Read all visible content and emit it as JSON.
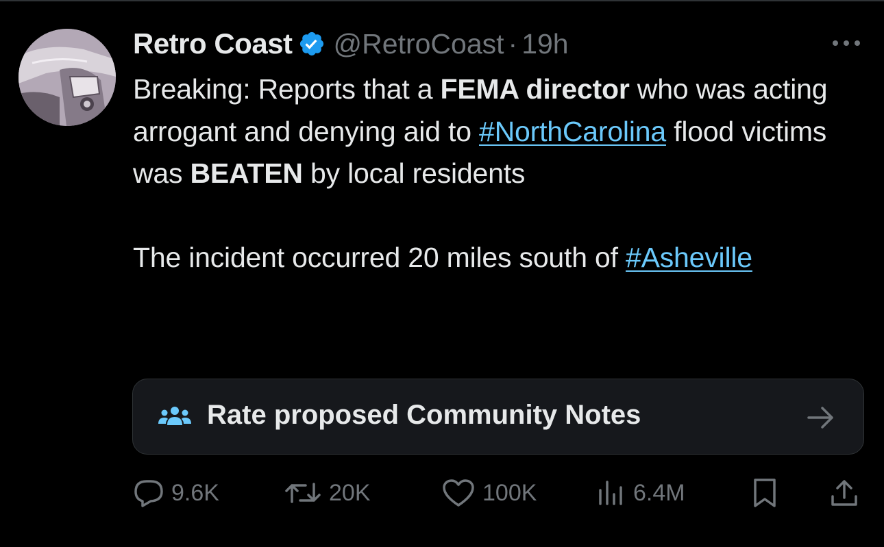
{
  "tweet": {
    "display_name": "Retro Coast",
    "handle": "@RetroCoast",
    "separator": "·",
    "timestamp": "19h",
    "more_label": "More",
    "text": {
      "p1_a": "Breaking: Reports that a ",
      "p1_b": "FEMA director",
      "p1_c": " who was acting arrogant and denying aid to ",
      "p1_hashtag": "#NorthCarolina",
      "p1_d": " flood victims was ",
      "p1_e": "BEATEN",
      "p1_f": " by local residents",
      "p2_a": "The incident occurred 20 miles south of ",
      "p2_hashtag": "#Asheville"
    }
  },
  "community_notes": {
    "label": "Rate proposed Community Notes"
  },
  "actions": {
    "replies": "9.6K",
    "reposts": "20K",
    "likes": "100K",
    "views": "6.4M"
  },
  "colors": {
    "background": "#000000",
    "text": "#e7e9ea",
    "secondary": "#71767b",
    "link": "#6bc9fb",
    "verified": "#1d9bf0",
    "card_bg": "#16181c",
    "border": "#2f3336"
  },
  "icons": {
    "verified": "verified-badge-icon",
    "more": "more-horizontal-icon",
    "community_notes": "community-notes-people-icon",
    "arrow": "arrow-right-icon",
    "reply": "reply-bubble-icon",
    "repost": "repost-arrows-icon",
    "like": "heart-icon",
    "views": "views-bar-chart-icon",
    "bookmark": "bookmark-icon",
    "share": "share-upload-icon"
  }
}
